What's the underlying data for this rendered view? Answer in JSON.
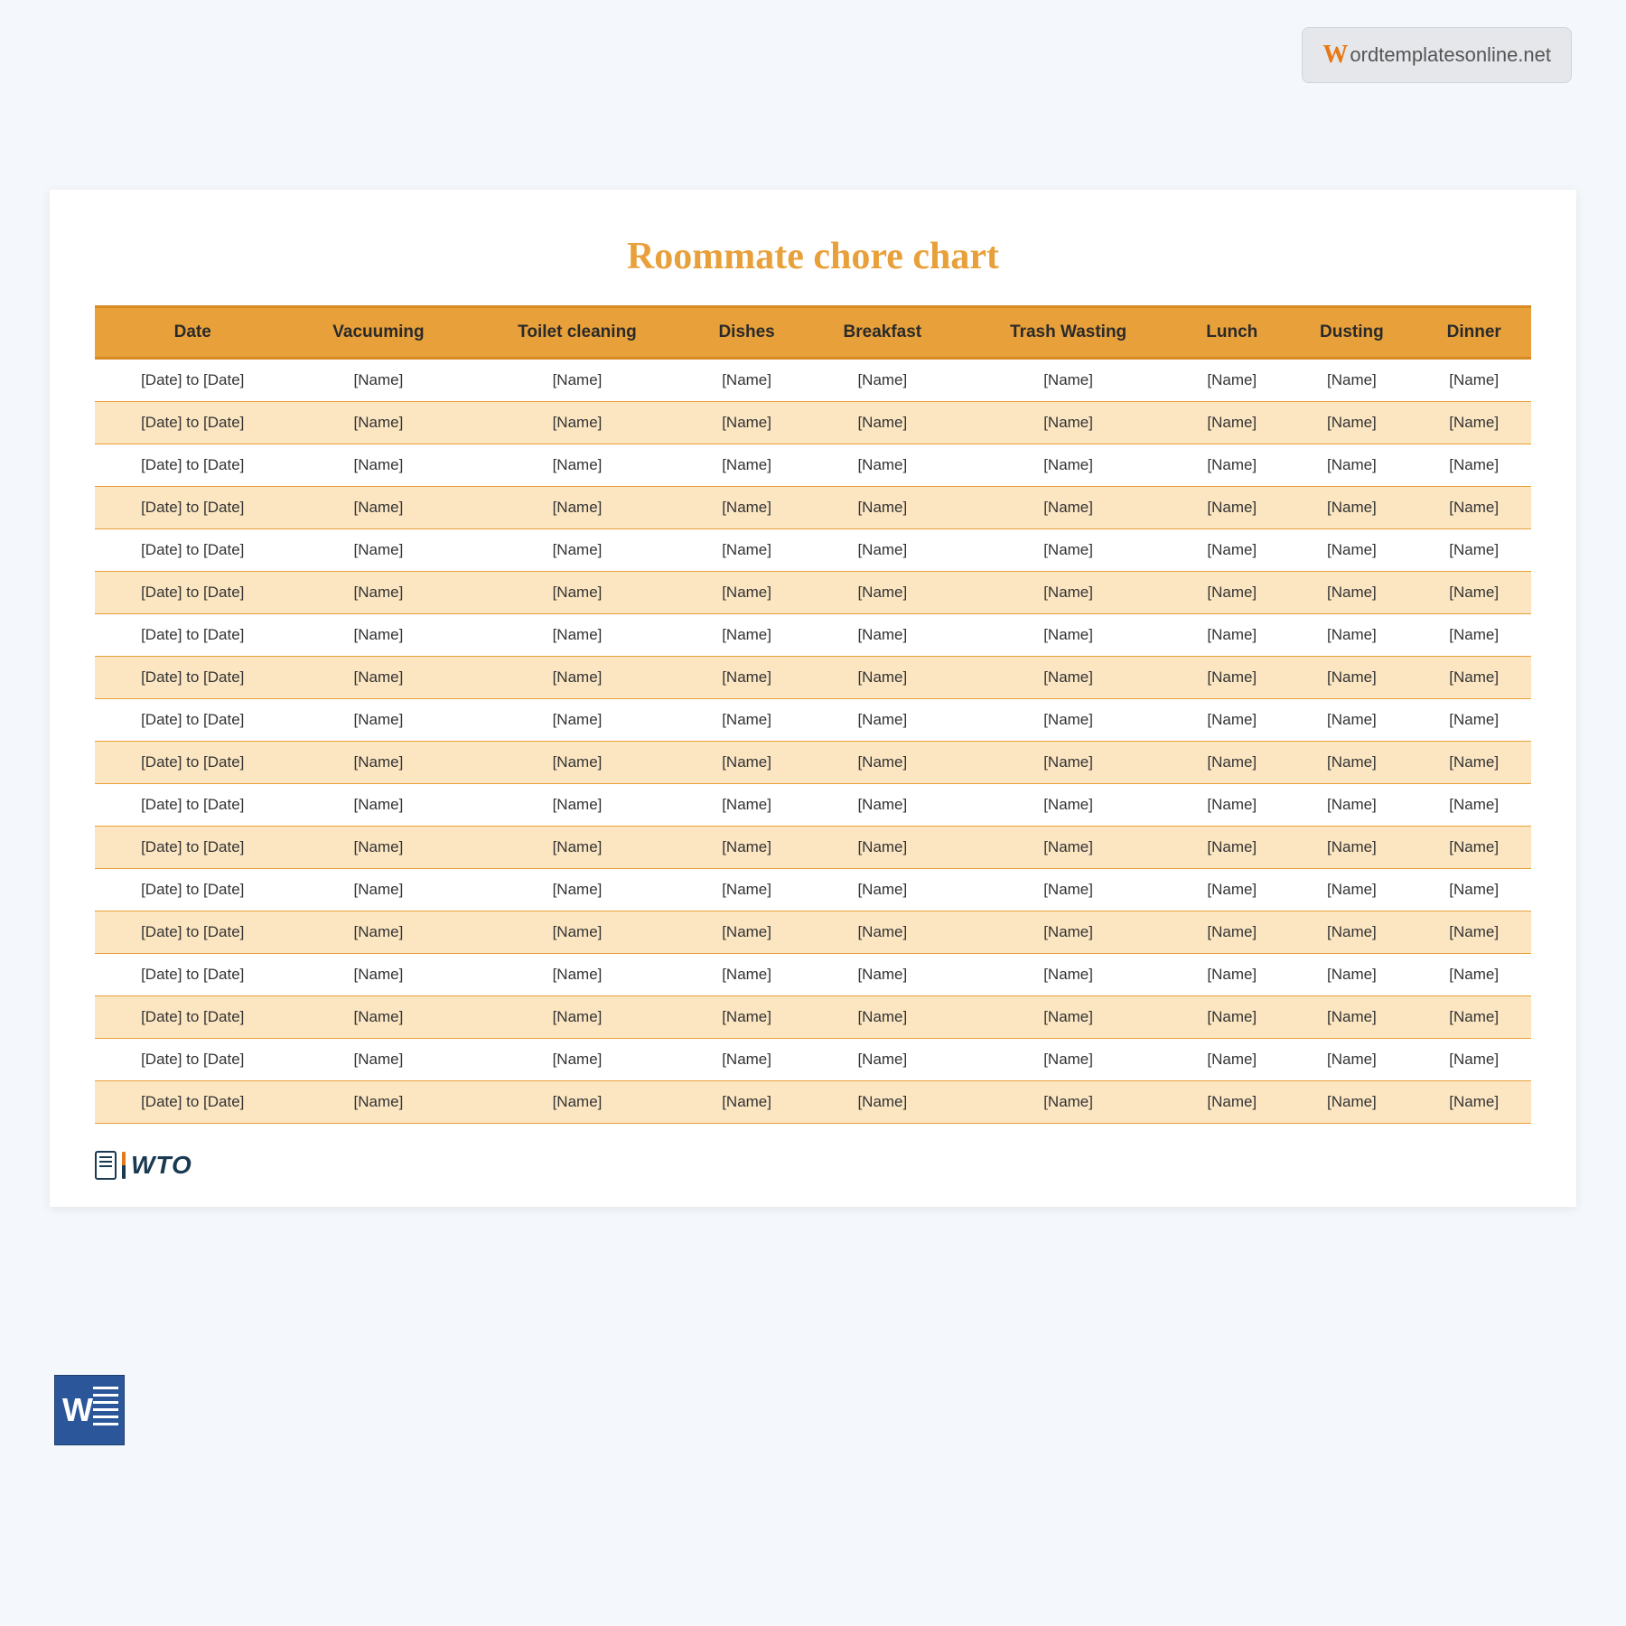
{
  "watermark": {
    "first_letter": "W",
    "rest": "ordtemplatesonline.net"
  },
  "title": "Roommate chore chart",
  "headers": [
    "Date",
    "Vacuuming",
    "Toilet cleaning",
    "Dishes",
    "Breakfast",
    "Trash Wasting",
    "Lunch",
    "Dusting",
    "Dinner"
  ],
  "rows": [
    [
      "[Date] to [Date]",
      "[Name]",
      "[Name]",
      "[Name]",
      "[Name]",
      "[Name]",
      "[Name]",
      "[Name]",
      "[Name]"
    ],
    [
      "[Date] to [Date]",
      "[Name]",
      "[Name]",
      "[Name]",
      "[Name]",
      "[Name]",
      "[Name]",
      "[Name]",
      "[Name]"
    ],
    [
      "[Date] to [Date]",
      "[Name]",
      "[Name]",
      "[Name]",
      "[Name]",
      "[Name]",
      "[Name]",
      "[Name]",
      "[Name]"
    ],
    [
      "[Date] to [Date]",
      "[Name]",
      "[Name]",
      "[Name]",
      "[Name]",
      "[Name]",
      "[Name]",
      "[Name]",
      "[Name]"
    ],
    [
      "[Date] to [Date]",
      "[Name]",
      "[Name]",
      "[Name]",
      "[Name]",
      "[Name]",
      "[Name]",
      "[Name]",
      "[Name]"
    ],
    [
      "[Date] to [Date]",
      "[Name]",
      "[Name]",
      "[Name]",
      "[Name]",
      "[Name]",
      "[Name]",
      "[Name]",
      "[Name]"
    ],
    [
      "[Date] to [Date]",
      "[Name]",
      "[Name]",
      "[Name]",
      "[Name]",
      "[Name]",
      "[Name]",
      "[Name]",
      "[Name]"
    ],
    [
      "[Date] to [Date]",
      "[Name]",
      "[Name]",
      "[Name]",
      "[Name]",
      "[Name]",
      "[Name]",
      "[Name]",
      "[Name]"
    ],
    [
      "[Date] to [Date]",
      "[Name]",
      "[Name]",
      "[Name]",
      "[Name]",
      "[Name]",
      "[Name]",
      "[Name]",
      "[Name]"
    ],
    [
      "[Date] to [Date]",
      "[Name]",
      "[Name]",
      "[Name]",
      "[Name]",
      "[Name]",
      "[Name]",
      "[Name]",
      "[Name]"
    ],
    [
      "[Date] to [Date]",
      "[Name]",
      "[Name]",
      "[Name]",
      "[Name]",
      "[Name]",
      "[Name]",
      "[Name]",
      "[Name]"
    ],
    [
      "[Date] to [Date]",
      "[Name]",
      "[Name]",
      "[Name]",
      "[Name]",
      "[Name]",
      "[Name]",
      "[Name]",
      "[Name]"
    ],
    [
      "[Date] to [Date]",
      "[Name]",
      "[Name]",
      "[Name]",
      "[Name]",
      "[Name]",
      "[Name]",
      "[Name]",
      "[Name]"
    ],
    [
      "[Date] to [Date]",
      "[Name]",
      "[Name]",
      "[Name]",
      "[Name]",
      "[Name]",
      "[Name]",
      "[Name]",
      "[Name]"
    ],
    [
      "[Date] to [Date]",
      "[Name]",
      "[Name]",
      "[Name]",
      "[Name]",
      "[Name]",
      "[Name]",
      "[Name]",
      "[Name]"
    ],
    [
      "[Date] to [Date]",
      "[Name]",
      "[Name]",
      "[Name]",
      "[Name]",
      "[Name]",
      "[Name]",
      "[Name]",
      "[Name]"
    ],
    [
      "[Date] to [Date]",
      "[Name]",
      "[Name]",
      "[Name]",
      "[Name]",
      "[Name]",
      "[Name]",
      "[Name]",
      "[Name]"
    ],
    [
      "[Date] to [Date]",
      "[Name]",
      "[Name]",
      "[Name]",
      "[Name]",
      "[Name]",
      "[Name]",
      "[Name]",
      "[Name]"
    ]
  ],
  "wto_logo_text": "WTO",
  "word_letter": "W"
}
